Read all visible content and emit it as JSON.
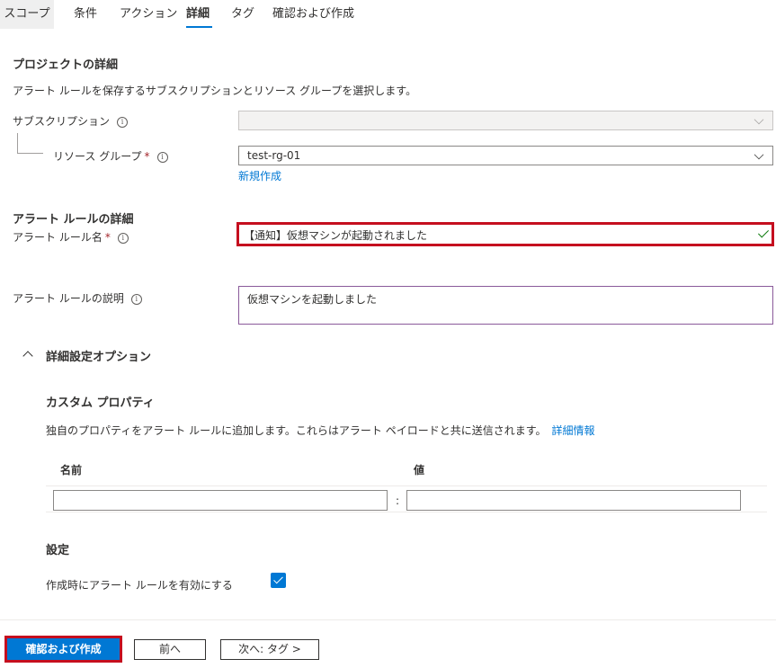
{
  "tabs": [
    "スコープ",
    "条件",
    "アクション",
    "詳細",
    "タグ",
    "確認および作成"
  ],
  "active_tab": "詳細",
  "project": {
    "title": "プロジェクトの詳細",
    "description": "アラート ルールを保存するサブスクリプションとリソース グループを選択します。",
    "subscription_label": "サブスクリプション",
    "subscription_value": "",
    "resource_group_label": "リソース グループ",
    "resource_group_value": "test-rg-01",
    "create_new": "新規作成"
  },
  "alert_details": {
    "title": "アラート ルールの詳細",
    "name_label": "アラート ルール名",
    "name_value": "【通知】仮想マシンが起動されました",
    "description_label": "アラート ルールの説明",
    "description_value": "仮想マシンを起動しました"
  },
  "advanced": {
    "toggle_label": "詳細設定オプション",
    "custom_props_title": "カスタム プロパティ",
    "custom_props_desc": "独自のプロパティをアラート ルールに追加します。これらはアラート ペイロードと共に送信されます。",
    "learn_more": "詳細情報",
    "name_col": "名前",
    "value_col": "値",
    "separator": ":",
    "settings_title": "設定",
    "enable_label": "作成時にアラート ルールを有効にする",
    "enable_checked": true
  },
  "footer": {
    "review_create": "確認および作成",
    "previous": "前へ",
    "next": "次へ: タグ >"
  },
  "colors": {
    "accent": "#0078d4",
    "highlight_border": "#c50f1f",
    "valid_check": "#107c10"
  },
  "required_mark": "*",
  "info_glyph": "i"
}
